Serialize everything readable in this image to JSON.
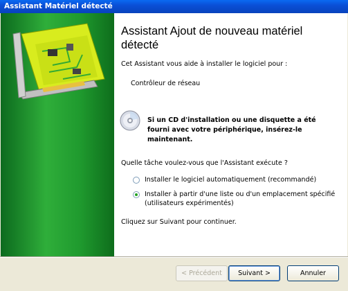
{
  "window": {
    "title": "Assistant Matériel détecté"
  },
  "content": {
    "heading": "Assistant Ajout de nouveau matériel détecté",
    "intro": "Cet Assistant vous aide à installer le logiciel pour :",
    "device": "Contrôleur de réseau",
    "cd_prompt": "Si un CD d'installation ou une disquette a été fourni avec votre périphérique, insérez-le maintenant.",
    "question": "Quelle tâche voulez-vous que l'Assistant exécute ?",
    "options": [
      {
        "label": "Installer le logiciel automatiquement (recommandé)",
        "selected": false
      },
      {
        "label_line1": "Installer à partir d'une liste ou d'un emplacement spécifié",
        "label_line2": "(utilisateurs expérimentés)",
        "selected": true
      }
    ],
    "continue_hint": "Cliquez sur Suivant pour continuer."
  },
  "buttons": {
    "back": "< Précédent",
    "next": "Suivant >",
    "cancel": "Annuler"
  },
  "colors": {
    "title_bar": "#0a4fd6",
    "side_panel": "#2fae3a",
    "radio_selected": "#21a121"
  }
}
